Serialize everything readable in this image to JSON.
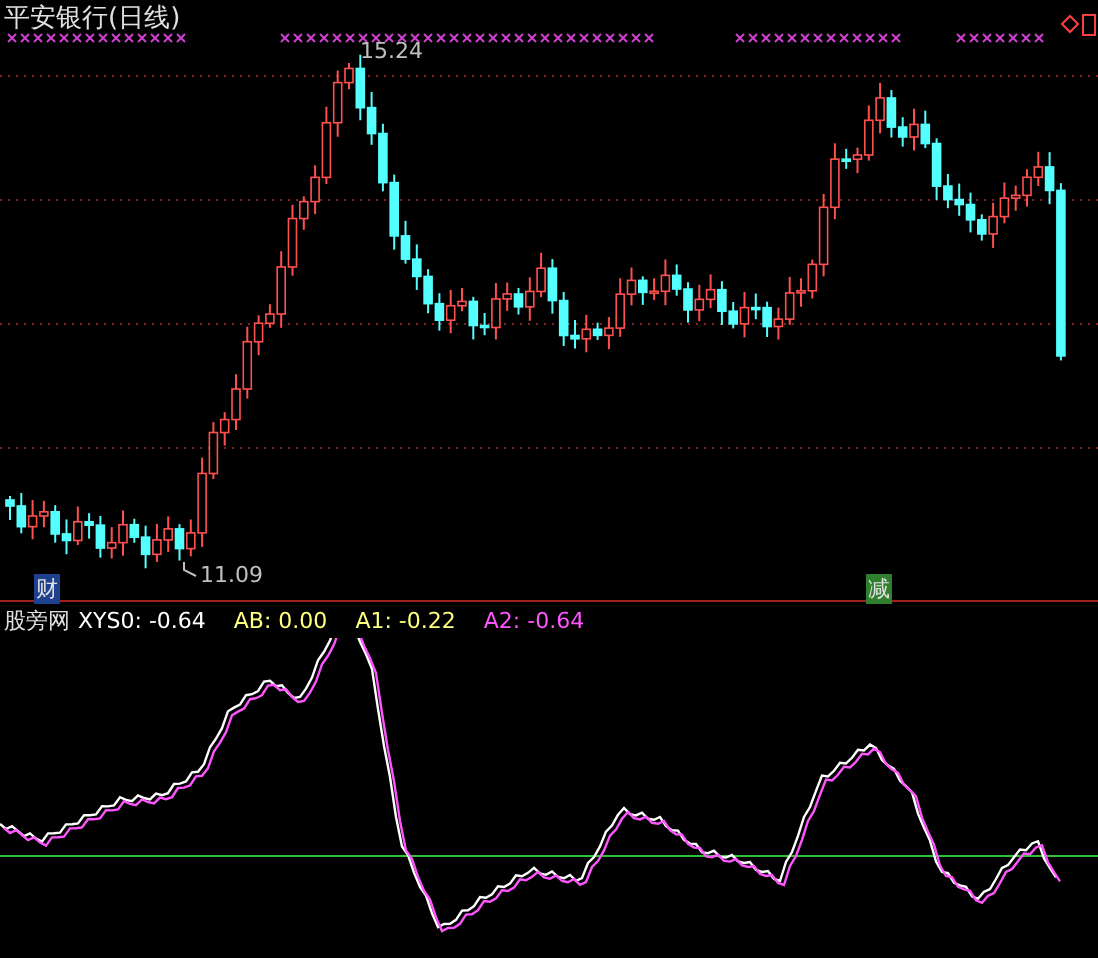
{
  "chart": {
    "title": "平安银行(日线)",
    "high_label": "15.24",
    "low_label": "11.09",
    "signals": [
      {
        "text": "财",
        "color": "#1f3f8f"
      },
      {
        "text": "减",
        "color": "#2f7f2f"
      }
    ]
  },
  "indicator": {
    "name": "股旁网",
    "values": [
      {
        "label": "XYS0:",
        "value": "-0.64",
        "color": "#ffffff"
      },
      {
        "label": "AB:",
        "value": "0.00",
        "color": "#ffff80"
      },
      {
        "label": "A1:",
        "value": "-0.22",
        "color": "#ffff80"
      },
      {
        "label": "A2:",
        "value": "-0.64",
        "color": "#ff55ff"
      }
    ]
  }
}
